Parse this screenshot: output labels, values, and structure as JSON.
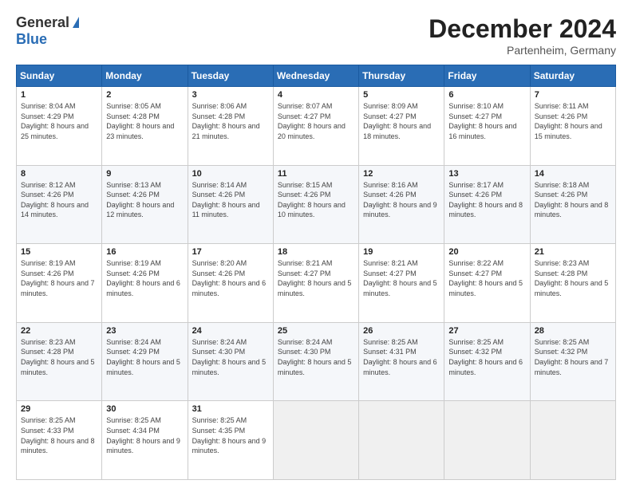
{
  "logo": {
    "general": "General",
    "blue": "Blue"
  },
  "title": {
    "month": "December 2024",
    "location": "Partenheim, Germany"
  },
  "days_of_week": [
    "Sunday",
    "Monday",
    "Tuesday",
    "Wednesday",
    "Thursday",
    "Friday",
    "Saturday"
  ],
  "weeks": [
    [
      {
        "day": "1",
        "sunrise": "8:04 AM",
        "sunset": "4:29 PM",
        "daylight": "8 hours and 25 minutes."
      },
      {
        "day": "2",
        "sunrise": "8:05 AM",
        "sunset": "4:28 PM",
        "daylight": "8 hours and 23 minutes."
      },
      {
        "day": "3",
        "sunrise": "8:06 AM",
        "sunset": "4:28 PM",
        "daylight": "8 hours and 21 minutes."
      },
      {
        "day": "4",
        "sunrise": "8:07 AM",
        "sunset": "4:27 PM",
        "daylight": "8 hours and 20 minutes."
      },
      {
        "day": "5",
        "sunrise": "8:09 AM",
        "sunset": "4:27 PM",
        "daylight": "8 hours and 18 minutes."
      },
      {
        "day": "6",
        "sunrise": "8:10 AM",
        "sunset": "4:27 PM",
        "daylight": "8 hours and 16 minutes."
      },
      {
        "day": "7",
        "sunrise": "8:11 AM",
        "sunset": "4:26 PM",
        "daylight": "8 hours and 15 minutes."
      }
    ],
    [
      {
        "day": "8",
        "sunrise": "8:12 AM",
        "sunset": "4:26 PM",
        "daylight": "8 hours and 14 minutes."
      },
      {
        "day": "9",
        "sunrise": "8:13 AM",
        "sunset": "4:26 PM",
        "daylight": "8 hours and 12 minutes."
      },
      {
        "day": "10",
        "sunrise": "8:14 AM",
        "sunset": "4:26 PM",
        "daylight": "8 hours and 11 minutes."
      },
      {
        "day": "11",
        "sunrise": "8:15 AM",
        "sunset": "4:26 PM",
        "daylight": "8 hours and 10 minutes."
      },
      {
        "day": "12",
        "sunrise": "8:16 AM",
        "sunset": "4:26 PM",
        "daylight": "8 hours and 9 minutes."
      },
      {
        "day": "13",
        "sunrise": "8:17 AM",
        "sunset": "4:26 PM",
        "daylight": "8 hours and 8 minutes."
      },
      {
        "day": "14",
        "sunrise": "8:18 AM",
        "sunset": "4:26 PM",
        "daylight": "8 hours and 8 minutes."
      }
    ],
    [
      {
        "day": "15",
        "sunrise": "8:19 AM",
        "sunset": "4:26 PM",
        "daylight": "8 hours and 7 minutes."
      },
      {
        "day": "16",
        "sunrise": "8:19 AM",
        "sunset": "4:26 PM",
        "daylight": "8 hours and 6 minutes."
      },
      {
        "day": "17",
        "sunrise": "8:20 AM",
        "sunset": "4:26 PM",
        "daylight": "8 hours and 6 minutes."
      },
      {
        "day": "18",
        "sunrise": "8:21 AM",
        "sunset": "4:27 PM",
        "daylight": "8 hours and 5 minutes."
      },
      {
        "day": "19",
        "sunrise": "8:21 AM",
        "sunset": "4:27 PM",
        "daylight": "8 hours and 5 minutes."
      },
      {
        "day": "20",
        "sunrise": "8:22 AM",
        "sunset": "4:27 PM",
        "daylight": "8 hours and 5 minutes."
      },
      {
        "day": "21",
        "sunrise": "8:23 AM",
        "sunset": "4:28 PM",
        "daylight": "8 hours and 5 minutes."
      }
    ],
    [
      {
        "day": "22",
        "sunrise": "8:23 AM",
        "sunset": "4:28 PM",
        "daylight": "8 hours and 5 minutes."
      },
      {
        "day": "23",
        "sunrise": "8:24 AM",
        "sunset": "4:29 PM",
        "daylight": "8 hours and 5 minutes."
      },
      {
        "day": "24",
        "sunrise": "8:24 AM",
        "sunset": "4:30 PM",
        "daylight": "8 hours and 5 minutes."
      },
      {
        "day": "25",
        "sunrise": "8:24 AM",
        "sunset": "4:30 PM",
        "daylight": "8 hours and 5 minutes."
      },
      {
        "day": "26",
        "sunrise": "8:25 AM",
        "sunset": "4:31 PM",
        "daylight": "8 hours and 6 minutes."
      },
      {
        "day": "27",
        "sunrise": "8:25 AM",
        "sunset": "4:32 PM",
        "daylight": "8 hours and 6 minutes."
      },
      {
        "day": "28",
        "sunrise": "8:25 AM",
        "sunset": "4:32 PM",
        "daylight": "8 hours and 7 minutes."
      }
    ],
    [
      {
        "day": "29",
        "sunrise": "8:25 AM",
        "sunset": "4:33 PM",
        "daylight": "8 hours and 8 minutes."
      },
      {
        "day": "30",
        "sunrise": "8:25 AM",
        "sunset": "4:34 PM",
        "daylight": "8 hours and 9 minutes."
      },
      {
        "day": "31",
        "sunrise": "8:25 AM",
        "sunset": "4:35 PM",
        "daylight": "8 hours and 9 minutes."
      },
      null,
      null,
      null,
      null
    ]
  ],
  "labels": {
    "sunrise": "Sunrise:",
    "sunset": "Sunset:",
    "daylight": "Daylight:"
  }
}
